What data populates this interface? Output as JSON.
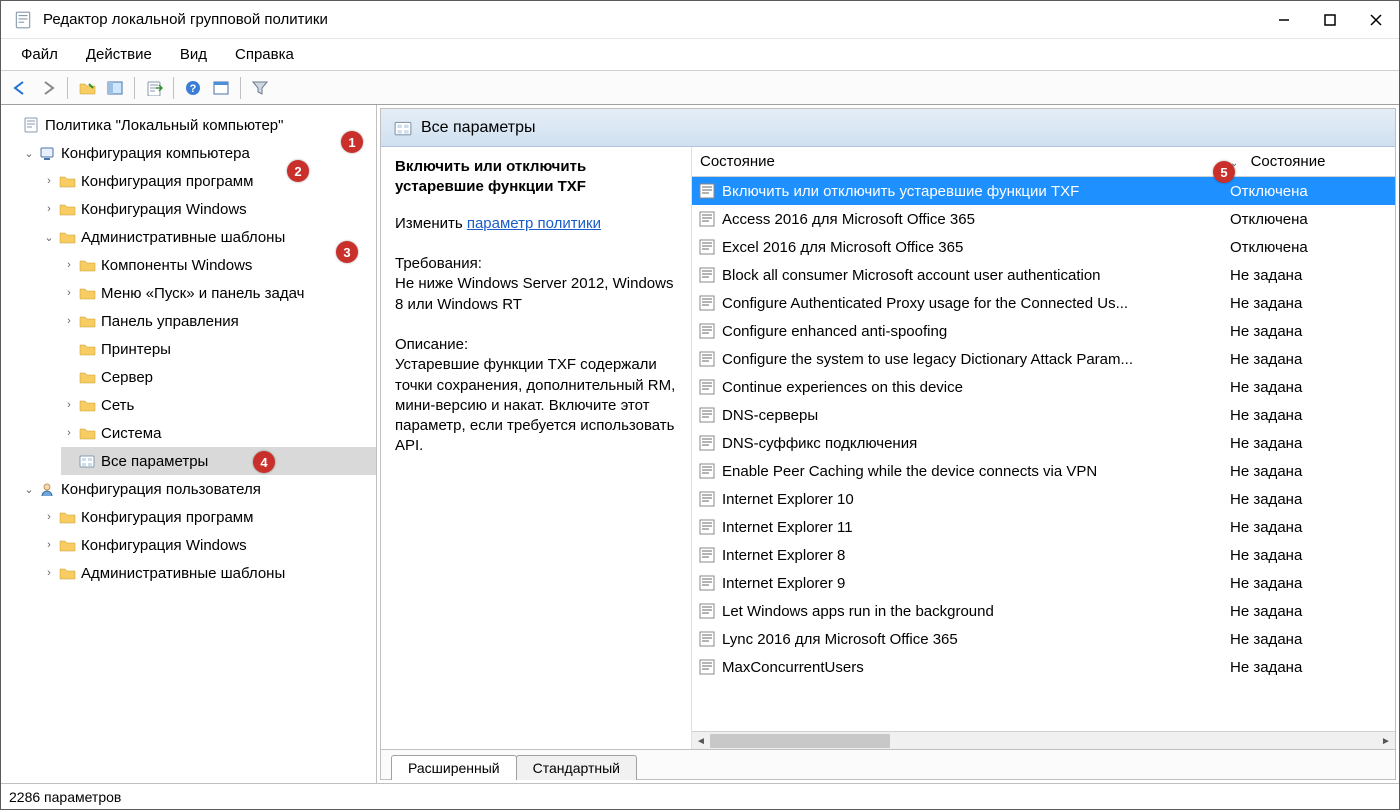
{
  "window": {
    "title": "Редактор локальной групповой политики"
  },
  "menu": {
    "file": "Файл",
    "action": "Действие",
    "view": "Вид",
    "help": "Справка"
  },
  "tree": {
    "root": "Политика \"Локальный компьютер\"",
    "comp_conf": "Конфигурация компьютера",
    "comp_soft": "Конфигурация программ",
    "comp_win": "Конфигурация Windows",
    "admin_tmpl": "Административные шаблоны",
    "at_components": "Компоненты Windows",
    "at_startmenu": "Меню «Пуск» и панель задач",
    "at_cpl": "Панель управления",
    "at_printers": "Принтеры",
    "at_server": "Сервер",
    "at_network": "Сеть",
    "at_system": "Система",
    "at_all": "Все параметры",
    "user_conf": "Конфигурация пользователя",
    "user_soft": "Конфигурация программ",
    "user_win": "Конфигурация Windows",
    "user_admin": "Административные шаблоны"
  },
  "panel": {
    "header": "Все параметры",
    "selected_title": "Включить или отключить устаревшие функции TXF",
    "edit_label": "Изменить",
    "edit_link": "параметр политики",
    "reqs_label": "Требования:",
    "reqs_text": "Не ниже Windows Server 2012, Windows 8 или Windows RT",
    "desc_label": "Описание:",
    "desc_text": "Устаревшие функции TXF содержали точки сохранения, дополнительный RM, мини-версию и накат. Включите этот параметр, если требуется использовать API."
  },
  "columns": {
    "state_left": "Состояние",
    "state_right": "Состояние"
  },
  "rows": [
    {
      "name": "Включить или отключить устаревшие функции TXF",
      "state": "Отключена",
      "sel": true
    },
    {
      "name": "Access 2016 для Microsoft Office 365",
      "state": "Отключена"
    },
    {
      "name": "Excel 2016 для Microsoft Office 365",
      "state": "Отключена"
    },
    {
      "name": "Block all consumer Microsoft account user authentication",
      "state": "Не задана"
    },
    {
      "name": "Configure Authenticated Proxy usage for the Connected Us...",
      "state": "Не задана"
    },
    {
      "name": "Configure enhanced anti-spoofing",
      "state": "Не задана"
    },
    {
      "name": "Configure the system to use legacy Dictionary Attack Param...",
      "state": "Не задана"
    },
    {
      "name": "Continue experiences on this device",
      "state": "Не задана"
    },
    {
      "name": "DNS-серверы",
      "state": "Не задана"
    },
    {
      "name": "DNS-суффикс подключения",
      "state": "Не задана"
    },
    {
      "name": "Enable Peer Caching while the device connects via VPN",
      "state": "Не задана"
    },
    {
      "name": "Internet Explorer 10",
      "state": "Не задана"
    },
    {
      "name": "Internet Explorer 11",
      "state": "Не задана"
    },
    {
      "name": "Internet Explorer 8",
      "state": "Не задана"
    },
    {
      "name": "Internet Explorer 9",
      "state": "Не задана"
    },
    {
      "name": "Let Windows apps run in the background",
      "state": "Не задана"
    },
    {
      "name": "Lync 2016 для Microsoft Office 365",
      "state": "Не задана"
    },
    {
      "name": "MaxConcurrentUsers",
      "state": "Не задана"
    }
  ],
  "tabs": {
    "extended": "Расширенный",
    "standard": "Стандартный"
  },
  "status": "2286 параметров",
  "badges": {
    "b1": "1",
    "b2": "2",
    "b3": "3",
    "b4": "4",
    "b5": "5"
  }
}
